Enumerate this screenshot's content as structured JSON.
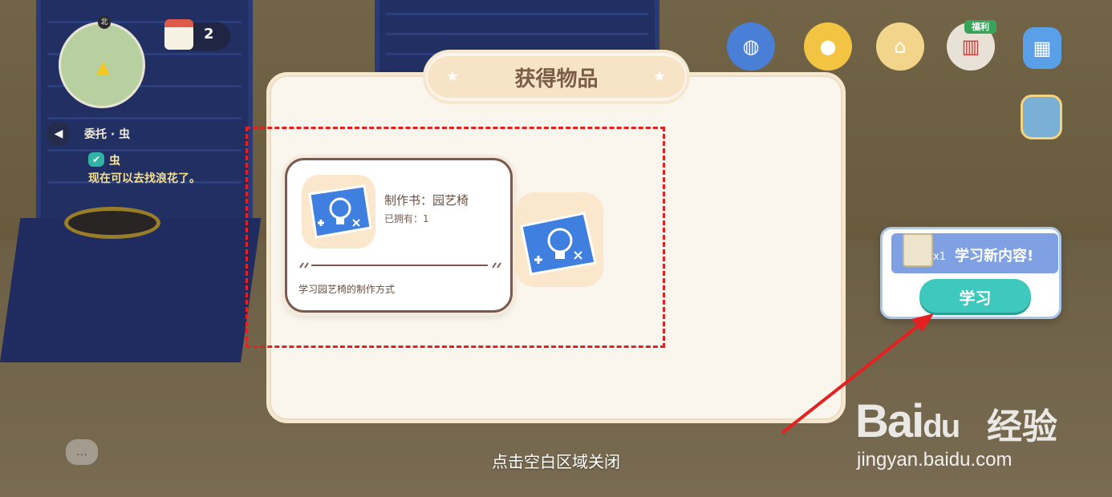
{
  "hud": {
    "calendar_count": "2",
    "quest_title": "委托 · 虫",
    "quest_item": "虫",
    "quest_desc": "现在可以去找浪花了。",
    "bonus_tag": "福利",
    "icons": [
      "planet-icon",
      "duck-icon",
      "shop-icon",
      "cart-icon",
      "phone-icon",
      "backpack-icon"
    ]
  },
  "dialog": {
    "title": "获得物品",
    "item": {
      "name": "制作书：园艺椅",
      "owned": "已拥有：1",
      "description": "学习园艺椅的制作方式"
    },
    "close_hint": "点击空白区域关闭"
  },
  "learn_popup": {
    "count": "x1",
    "text": "学习新内容!",
    "button": "学习"
  },
  "watermark": {
    "bai": "Bai",
    "du": "du",
    "cn": "经验",
    "url": "jingyan.baidu.com"
  },
  "colors": {
    "highlight": "#e52020",
    "learn_button": "#3fc8bd",
    "dialog_bg": "#faf5ed"
  }
}
